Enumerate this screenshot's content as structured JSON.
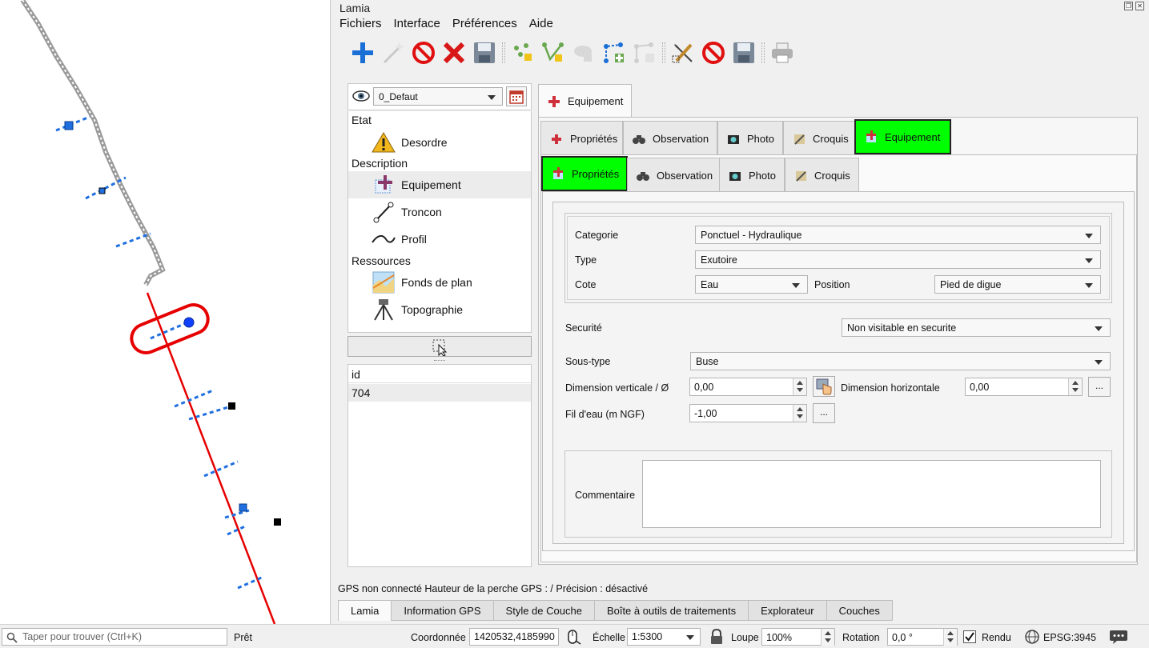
{
  "window": {
    "title": "Lamia"
  },
  "menu": [
    "Fichiers",
    "Interface",
    "Préférences",
    "Aide"
  ],
  "toolbar": {
    "icons": [
      "add-icon",
      "magic-wand-icon",
      "forbidden-icon",
      "delete-icon",
      "save-icon",
      "node-add-icon",
      "vertex-edit-icon",
      "cloud-icon",
      "path-add-icon",
      "topology-icon",
      "edit-tool-icon",
      "forbidden-icon",
      "save-icon",
      "print-icon"
    ]
  },
  "version": {
    "selected": "0_Defaut"
  },
  "tree": {
    "groups": [
      {
        "label": "Etat",
        "items": [
          {
            "label": "Desordre",
            "icon": "warning-icon"
          }
        ]
      },
      {
        "label": "Description",
        "items": [
          {
            "label": "Equipement",
            "icon": "equipment-icon",
            "selected": true
          },
          {
            "label": "Troncon",
            "icon": "line-icon"
          },
          {
            "label": "Profil",
            "icon": "profile-icon"
          }
        ]
      },
      {
        "label": "Ressources",
        "items": [
          {
            "label": "Fonds de plan",
            "icon": "map-icon"
          },
          {
            "label": "Topographie",
            "icon": "tripod-icon"
          }
        ]
      }
    ]
  },
  "id_table": {
    "header": "id",
    "rows": [
      "704"
    ]
  },
  "top_tab": {
    "label": "Equipement"
  },
  "tabs_level1": [
    "Propriétés",
    "Observation",
    "Photo",
    "Croquis",
    "Equipement"
  ],
  "tabs_level2": [
    "Propriétés",
    "Observation",
    "Photo",
    "Croquis"
  ],
  "form": {
    "categorie": {
      "label": "Categorie",
      "value": "Ponctuel - Hydraulique"
    },
    "type": {
      "label": "Type",
      "value": "Exutoire"
    },
    "cote": {
      "label": "Cote",
      "value": "Eau"
    },
    "position": {
      "label": "Position",
      "value": "Pied de digue"
    },
    "securite": {
      "label": "Securité",
      "value": "Non visitable en securite"
    },
    "soustype": {
      "label": "Sous-type",
      "value": "Buse"
    },
    "dim_vert": {
      "label": "Dimension verticale / Ø",
      "value": "0,00"
    },
    "dim_horiz": {
      "label": "Dimension horizontale",
      "value": "0,00"
    },
    "fil_eau": {
      "label": "Fil d'eau (m NGF)",
      "value": "-1,00"
    },
    "more_label": "...",
    "commentaire": {
      "label": "Commentaire",
      "value": ""
    }
  },
  "gps_status": "GPS non connecté  Hauteur de la perche GPS : /  Précision : désactivé",
  "bottom_tabs": [
    "Lamia",
    "Information GPS",
    "Style de Couche",
    "Boîte à outils de traitements",
    "Explorateur",
    "Couches"
  ],
  "statusbar": {
    "search_placeholder": "Taper pour trouver (Ctrl+K)",
    "ready": "Prêt",
    "coord_label": "Coordonnée",
    "coord_value": "1420532,4185990",
    "scale_label": "Échelle",
    "scale_value": "1:5300",
    "zoom_label": "Loupe",
    "zoom_value": "100%",
    "rotation_label": "Rotation",
    "rotation_value": "0,0 °",
    "render_label": "Rendu",
    "crs": "EPSG:3945"
  }
}
